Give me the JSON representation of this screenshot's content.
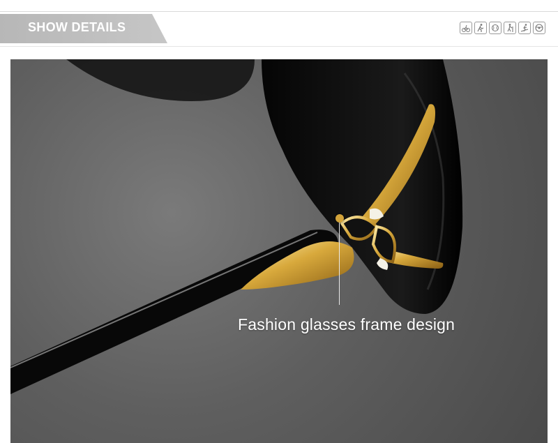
{
  "header": {
    "title": "SHOW DETAILS",
    "activity_icons": [
      "cycling-icon",
      "running-icon",
      "tennis-icon",
      "hiking-icon",
      "skiing-icon",
      "driving-icon"
    ]
  },
  "feature": {
    "caption": "Fashion glasses frame design",
    "accent_color": "#d2a33a"
  }
}
